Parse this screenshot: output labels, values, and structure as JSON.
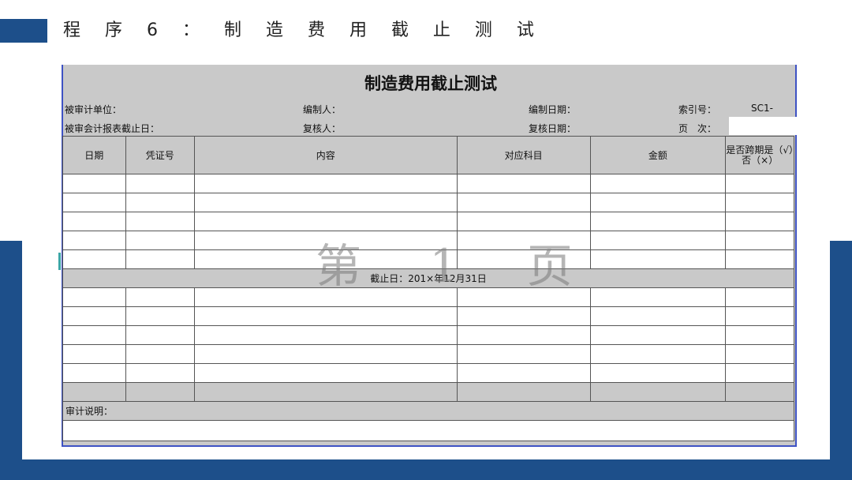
{
  "slide": {
    "title": "程 序 6 ： 制 造 费 用 截 止 测 试"
  },
  "sheet": {
    "title": "制造费用截止测试",
    "fields": {
      "audited_unit": "被审计单位：",
      "preparer": "编制人：",
      "prep_date": "编制日期：",
      "index_label": "索引号：",
      "index_value": "SC1-",
      "report_end_date": "被审会计报表截止日：",
      "reviewer": "复核人：",
      "review_date": "复核日期：",
      "page_no": "页　次："
    },
    "columns": [
      "日期",
      "凭证号",
      "内容",
      "对应科目",
      "金额",
      "是否跨期是（√）否（×）"
    ],
    "cutoff_label": "截止日：201×年12月31日",
    "note_label": "审计说明：",
    "watermark": "第 1 页"
  },
  "colors": {
    "brand_blue": "#1d4f8a",
    "sheet_gray": "#c9c9c9",
    "border_blue": "#3e52c4"
  }
}
